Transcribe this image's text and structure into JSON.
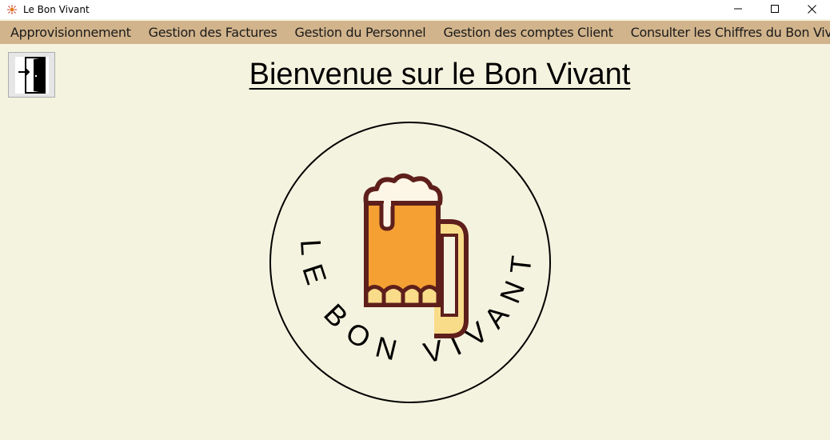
{
  "window": {
    "title": "Le Bon Vivant",
    "controls": [
      "minimize-icon",
      "maximize-icon",
      "close-icon"
    ]
  },
  "menubar": {
    "items": [
      {
        "label": "Approvisionnement"
      },
      {
        "label": "Gestion des Factures"
      },
      {
        "label": "Gestion du Personnel"
      },
      {
        "label": "Gestion des comptes Client"
      },
      {
        "label": "Consulter les Chiffres du Bon Vivant"
      }
    ]
  },
  "exit_button": {
    "icon": "exit-door-icon"
  },
  "main": {
    "title": "Bienvenue sur le Bon Vivant",
    "logo_text": "LE BON VIVANT",
    "logo_icon": "beer-mug-icon"
  },
  "colors": {
    "menubar": "#d2b48c",
    "background": "#f4f3df",
    "beer": "#f4a033",
    "foam": "#fdf6e6",
    "mug_outline": "#5e1f1b",
    "mug_glass": "#f9dc8a"
  }
}
